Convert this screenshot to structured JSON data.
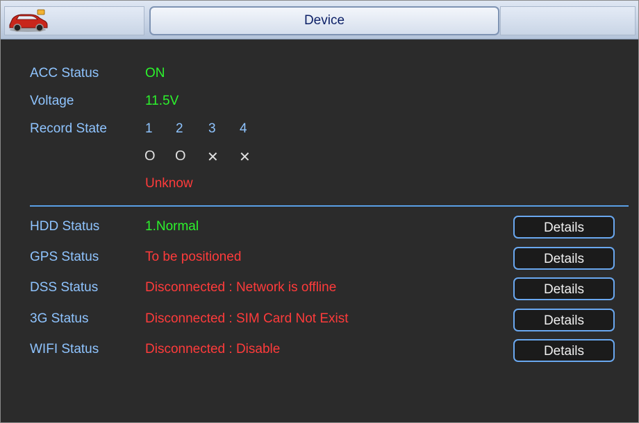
{
  "window": {
    "title": "Device"
  },
  "icons": {
    "app_icon": "car-icon"
  },
  "colors": {
    "label": "#8fc4ff",
    "ok": "#2cf32c",
    "error": "#ff3b3b",
    "accent": "#6aa8f0"
  },
  "info": {
    "acc_label": "ACC Status",
    "acc_value": "ON",
    "voltage_label": "Voltage",
    "voltage_value": "11.5V",
    "record_label": "Record State",
    "channels": [
      "1",
      "2",
      "3",
      "4"
    ],
    "channel_marks": [
      "O",
      "O",
      "✕",
      "✕"
    ],
    "record_result": "Unknow"
  },
  "statuses": [
    {
      "label": "HDD Status",
      "value": "1.Normal",
      "button": "Details"
    },
    {
      "label": "GPS Status",
      "value": "To be positioned",
      "button": "Details"
    },
    {
      "label": "DSS Status",
      "value": "Disconnected : Network is offline",
      "button": "Details"
    },
    {
      "label": "3G Status",
      "value": "Disconnected : SIM Card Not Exist",
      "button": "Details"
    },
    {
      "label": "WIFI Status",
      "value": "Disconnected : Disable",
      "button": "Details"
    }
  ]
}
